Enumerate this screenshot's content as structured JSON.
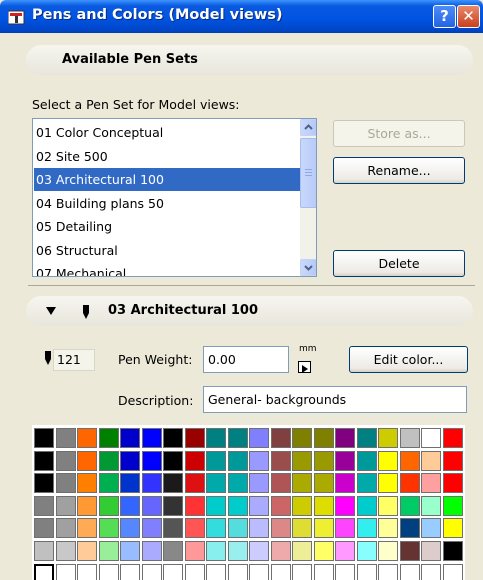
{
  "window": {
    "title": "Pens and Colors (Model views)",
    "help_glyph": "?",
    "close_glyph": "✕"
  },
  "pen_sets_section": {
    "title": "Available Pen Sets",
    "select_label": "Select a Pen Set for Model views:",
    "items": [
      "01 Color Conceptual",
      "02 Site 500",
      "03 Architectural 100",
      "04 Building plans 50",
      "05 Detailing",
      "06 Structural",
      "07 Mechanical"
    ],
    "selected_index": 2,
    "buttons": {
      "store_as": "Store as...",
      "rename": "Rename...",
      "delete": "Delete"
    }
  },
  "pen_set_detail": {
    "title": "03 Architectural 100",
    "pen_number": "121",
    "pen_weight_label": "Pen Weight:",
    "pen_weight_value": "0.00",
    "unit": "mm",
    "edit_color_label": "Edit color...",
    "description_label": "Description:",
    "description_value": "General- backgrounds"
  },
  "palette": {
    "rows": [
      [
        "#000000",
        "#808080",
        "#ff6600",
        "#008000",
        "#0000cc",
        "#0000ff",
        "#000000",
        "#990000",
        "#008080",
        "#008080",
        "#8080ff",
        "#804040",
        "#808000",
        "#808000",
        "#800080",
        "#008080",
        "#cccc00",
        "#c0c0c0",
        "#ffffff",
        "#ff0000"
      ],
      [
        "#000000",
        "#808080",
        "#ff6600",
        "#009933",
        "#0000cc",
        "#0000ff",
        "#000000",
        "#cc0000",
        "#009999",
        "#009999",
        "#9999ff",
        "#994d4d",
        "#999900",
        "#999900",
        "#990099",
        "#009999",
        "#ffff00",
        "#ff6600",
        "#ffcc99",
        "#ff0000"
      ],
      [
        "#000000",
        "#808080",
        "#ff8000",
        "#00b050",
        "#0033cc",
        "#3333ff",
        "#1a1a1a",
        "#dd1111",
        "#00aaaa",
        "#00aaaa",
        "#9999ff",
        "#b05555",
        "#aaaa00",
        "#aaaa00",
        "#cc00cc",
        "#00aaaa",
        "#ffff00",
        "#ff3300",
        "#ffa0a0",
        "#ff0000"
      ],
      [
        "#808080",
        "#a0a0a0",
        "#ff9933",
        "#33cc33",
        "#3366ff",
        "#6666ff",
        "#333333",
        "#ff3333",
        "#00cccc",
        "#00cccc",
        "#aaaaff",
        "#cc6666",
        "#cccc00",
        "#dddd00",
        "#ff00ff",
        "#00cccc",
        "#ffff66",
        "#00cc66",
        "#99ffcc",
        "#00ff00"
      ],
      [
        "#808080",
        "#a0a0a0",
        "#ffaa55",
        "#55dd55",
        "#5588ff",
        "#8080ff",
        "#555555",
        "#ff5555",
        "#33dddd",
        "#55dddd",
        "#bbbbff",
        "#dd8888",
        "#dddd33",
        "#eeee33",
        "#ff44ff",
        "#33eeee",
        "#ffff99",
        "#004080",
        "#99ccff",
        "#ffff00"
      ],
      [
        "#c0c0c0",
        "#c8c8c8",
        "#ffcc99",
        "#99ee99",
        "#99bbff",
        "#aaaaff",
        "#888888",
        "#ff9999",
        "#88eeee",
        "#99eeee",
        "#ccccff",
        "#eeaaaa",
        "#eeee99",
        "#ffff66",
        "#ff99ff",
        "#88ffff",
        "#ffffcc",
        "#663333",
        "#ddcccc",
        "#000000"
      ],
      [
        "#ffffff",
        "#ffffff",
        "#ffffff",
        "#ffffff",
        "#ffffff",
        "#ffffff",
        "#ffffff",
        "#ffffff",
        "#ffffff",
        "#ffffff",
        "#ffffff",
        "#ffffff",
        "#ffffff",
        "#ffffff",
        "#ffffff",
        "#ffffff",
        "#ffffff",
        "#ffffff",
        "#ffffff",
        "#ffffff"
      ],
      [
        "#ffffff",
        "#ffffff",
        "#ffffff",
        "#ffffff",
        "#ffffff",
        "#ffffff",
        "#ffffff",
        "#ffffff",
        "#ffffff",
        "#ffffff",
        "#ffffff",
        "#ffffff",
        "#ffffff",
        "#ffffff",
        "#ffffff",
        "#ffffff",
        "#ffffff",
        "#ffffff",
        "#ffffff",
        "#ffffff"
      ]
    ],
    "selected_row": 6,
    "selected_col": 0
  },
  "colors": {
    "selection": "#316ac5",
    "titlebar": "#0054e3",
    "dialog_bg": "#ece9d8"
  }
}
